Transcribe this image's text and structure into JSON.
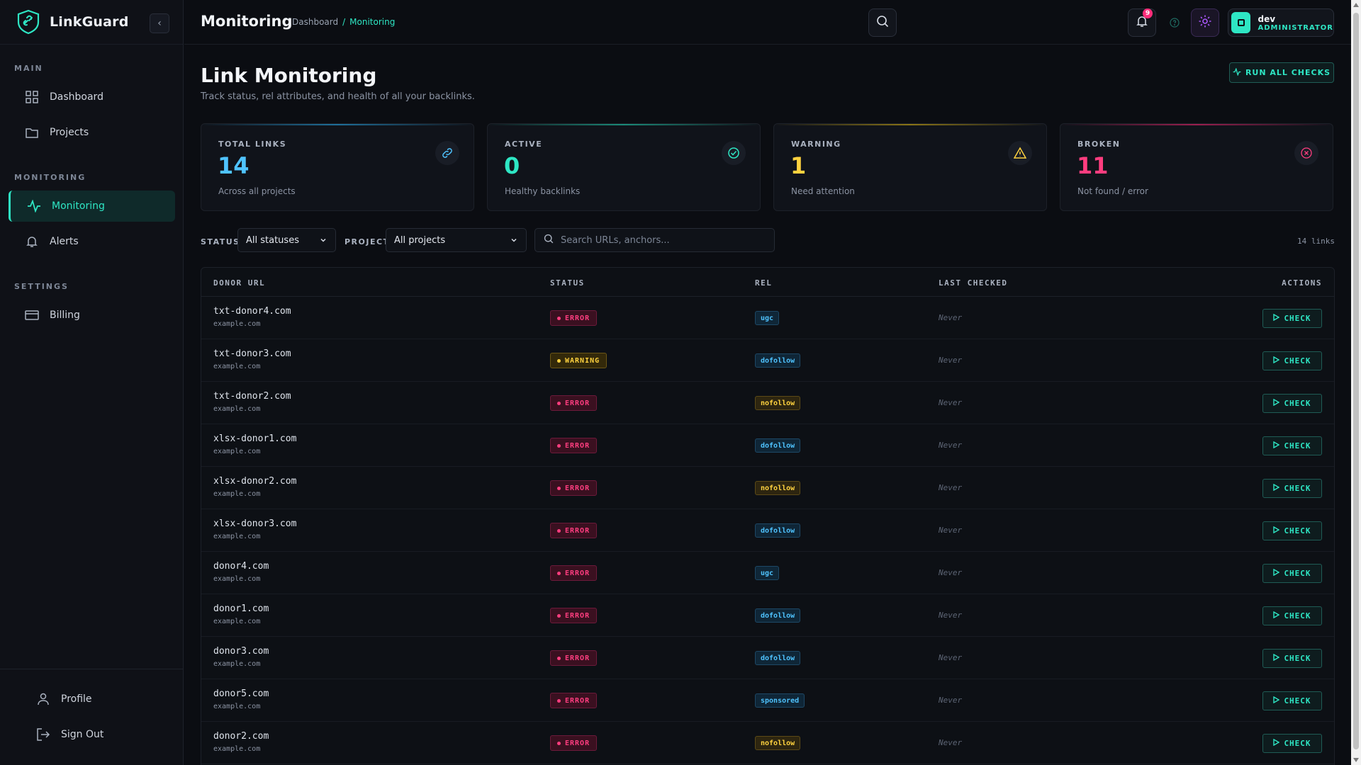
{
  "app": {
    "name": "LinkGuard"
  },
  "sidebar": {
    "sections": [
      {
        "label": "MAIN",
        "items": [
          {
            "label": "Dashboard",
            "icon": "grid-icon"
          },
          {
            "label": "Projects",
            "icon": "folder-icon"
          }
        ]
      },
      {
        "label": "MONITORING",
        "items": [
          {
            "label": "Monitoring",
            "icon": "activity-icon",
            "active": true
          },
          {
            "label": "Alerts",
            "icon": "bell-icon"
          }
        ]
      },
      {
        "label": "SETTINGS",
        "items": [
          {
            "label": "Billing",
            "icon": "credit-card-icon"
          }
        ]
      }
    ],
    "bottom": [
      {
        "label": "Profile",
        "icon": "user-icon"
      },
      {
        "label": "Sign Out",
        "icon": "sign-out-icon"
      }
    ]
  },
  "topbar": {
    "title": "Monitoring",
    "breadcrumb": {
      "parent": "Dashboard",
      "separator": "/",
      "current": "Monitoring"
    },
    "notifications_count": "9",
    "user": {
      "name": "dev",
      "role": "ADMINISTRATOR"
    }
  },
  "page": {
    "title": "Link Monitoring",
    "subtitle": "Track status, rel attributes, and health of all your backlinks.",
    "run_button": "RUN ALL CHECKS"
  },
  "stats": [
    {
      "label": "TOTAL LINKS",
      "value": "14",
      "desc": "Across all projects",
      "color": "#4fc3ff",
      "icon": "link-icon"
    },
    {
      "label": "ACTIVE",
      "value": "0",
      "desc": "Healthy backlinks",
      "color": "#2ee6c4",
      "icon": "check-circle-icon"
    },
    {
      "label": "WARNING",
      "value": "1",
      "desc": "Need attention",
      "color": "#ffd23f",
      "icon": "warning-icon"
    },
    {
      "label": "BROKEN",
      "value": "11",
      "desc": "Not found / error",
      "color": "#ff3d7f",
      "icon": "x-circle-icon"
    }
  ],
  "filters": {
    "status_label": "STATUS",
    "status_value": "All statuses",
    "project_label": "PROJECT",
    "project_value": "All projects",
    "search_placeholder": "Search URLs, anchors...",
    "count": "14 links"
  },
  "table": {
    "headers": {
      "donor": "DONOR URL",
      "status": "STATUS",
      "rel": "REL",
      "last_checked": "LAST CHECKED",
      "actions": "ACTIONS"
    },
    "check_label": "CHECK",
    "rows": [
      {
        "donor": "txt-donor4.com",
        "target": "example.com",
        "status": "ERROR",
        "rel": "ugc",
        "last_checked": "Never"
      },
      {
        "donor": "txt-donor3.com",
        "target": "example.com",
        "status": "WARNING",
        "rel": "dofollow",
        "last_checked": "Never"
      },
      {
        "donor": "txt-donor2.com",
        "target": "example.com",
        "status": "ERROR",
        "rel": "nofollow",
        "last_checked": "Never"
      },
      {
        "donor": "xlsx-donor1.com",
        "target": "example.com",
        "status": "ERROR",
        "rel": "dofollow",
        "last_checked": "Never"
      },
      {
        "donor": "xlsx-donor2.com",
        "target": "example.com",
        "status": "ERROR",
        "rel": "nofollow",
        "last_checked": "Never"
      },
      {
        "donor": "xlsx-donor3.com",
        "target": "example.com",
        "status": "ERROR",
        "rel": "dofollow",
        "last_checked": "Never"
      },
      {
        "donor": "donor4.com",
        "target": "example.com",
        "status": "ERROR",
        "rel": "ugc",
        "last_checked": "Never"
      },
      {
        "donor": "donor1.com",
        "target": "example.com",
        "status": "ERROR",
        "rel": "dofollow",
        "last_checked": "Never"
      },
      {
        "donor": "donor3.com",
        "target": "example.com",
        "status": "ERROR",
        "rel": "dofollow",
        "last_checked": "Never"
      },
      {
        "donor": "donor5.com",
        "target": "example.com",
        "status": "ERROR",
        "rel": "sponsored",
        "last_checked": "Never"
      },
      {
        "donor": "donor2.com",
        "target": "example.com",
        "status": "ERROR",
        "rel": "nofollow",
        "last_checked": "Never"
      }
    ]
  },
  "colors": {
    "accent": "#2ee6c4",
    "error": "#ff3d7f",
    "warning": "#ffd23f",
    "info": "#4fc3ff",
    "purple": "#a855f7"
  }
}
